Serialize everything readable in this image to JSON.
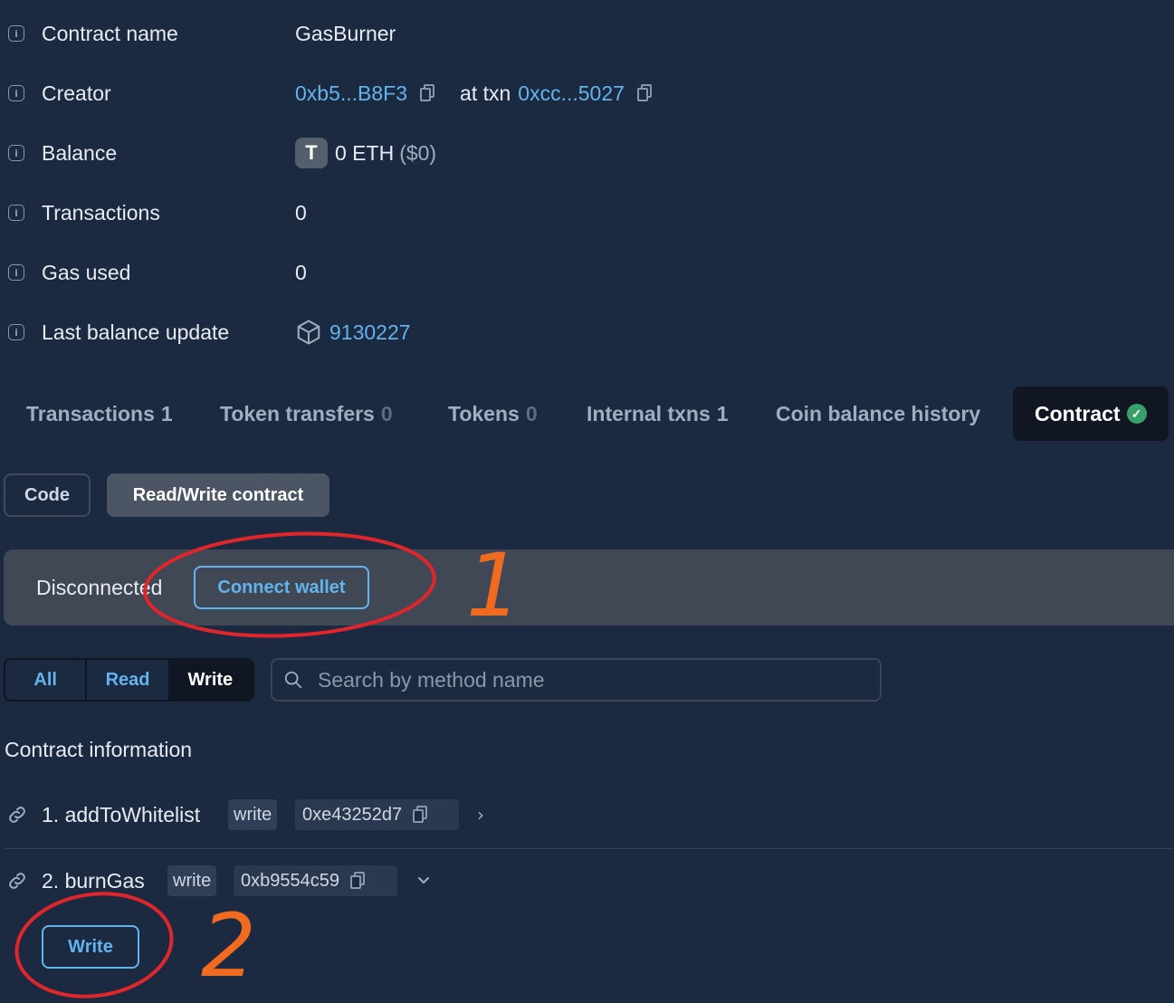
{
  "details": {
    "contract_name_label": "Contract name",
    "contract_name_value": "GasBurner",
    "creator_label": "Creator",
    "creator_address": "0xb5...B8F3",
    "at_txn_text": "at txn",
    "creator_txn": "0xcc...5027",
    "balance_label": "Balance",
    "balance_token_letter": "T",
    "balance_value": "0 ETH",
    "balance_usd": "($0)",
    "transactions_label": "Transactions",
    "transactions_value": "0",
    "gas_used_label": "Gas used",
    "gas_used_value": "0",
    "last_update_label": "Last balance update",
    "last_update_block": "9130227"
  },
  "tabs": [
    {
      "label": "Transactions",
      "count": "1"
    },
    {
      "label": "Token transfers",
      "count": "0"
    },
    {
      "label": "Tokens",
      "count": "0"
    },
    {
      "label": "Internal txns",
      "count": "1"
    },
    {
      "label": "Coin balance history",
      "count": ""
    },
    {
      "label": "Contract",
      "count": ""
    }
  ],
  "subtabs": {
    "code": "Code",
    "rw": "Read/Write contract"
  },
  "wallet": {
    "status": "Disconnected",
    "connect_label": "Connect wallet"
  },
  "filter": {
    "all": "All",
    "read": "Read",
    "write": "Write"
  },
  "search": {
    "placeholder": "Search by method name"
  },
  "section_title": "Contract information",
  "methods": [
    {
      "name": "1. addToWhitelist",
      "tag": "write",
      "selector": "0xe43252d7"
    },
    {
      "name": "2. burnGas",
      "tag": "write",
      "selector": "0xb9554c59"
    }
  ],
  "write_button": "Write",
  "annotations": {
    "n1": "1",
    "n2": "2"
  },
  "colors": {
    "background": "#1b2a40",
    "link": "#63b3ed",
    "annotation_circle": "#e0262b",
    "annotation_number": "#f06a1f",
    "verified": "#38a169"
  }
}
